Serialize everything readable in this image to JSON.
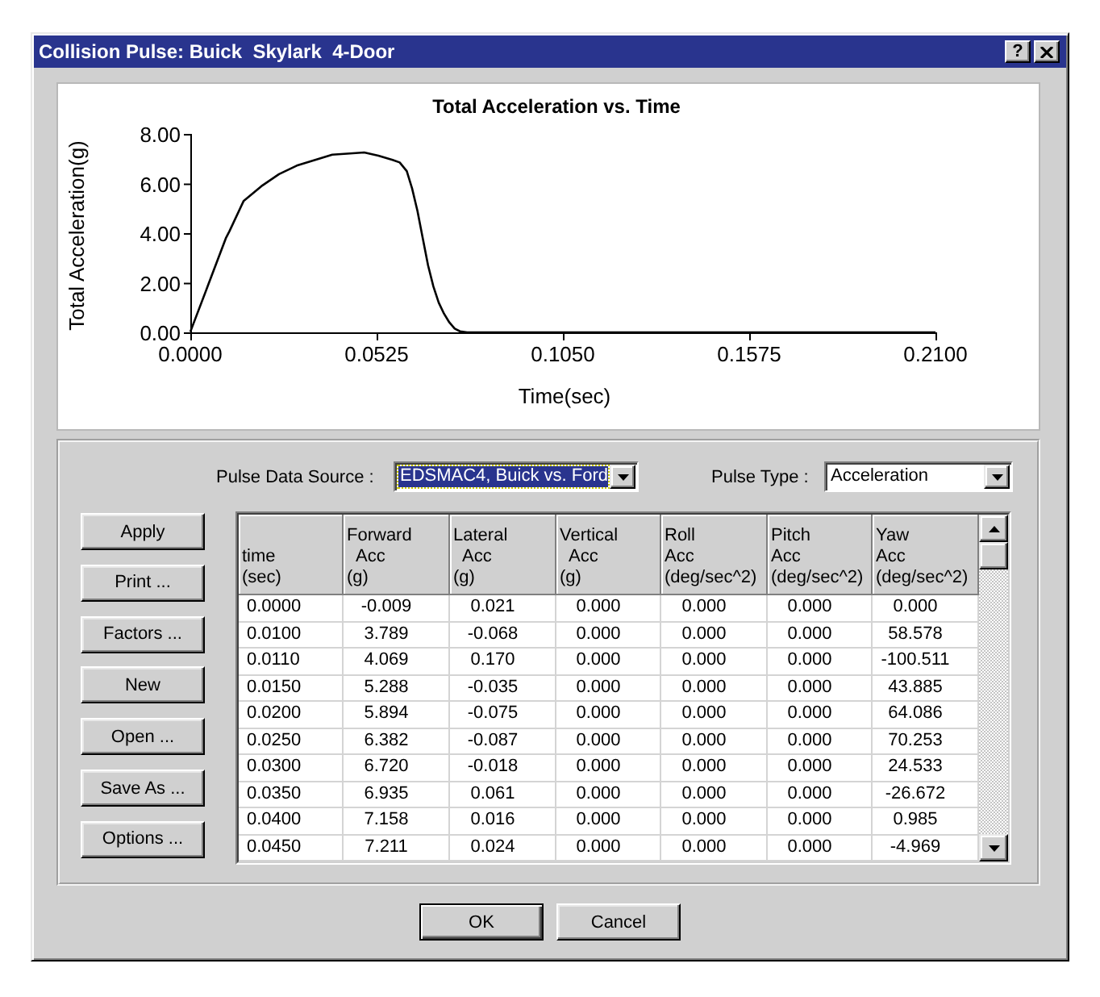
{
  "window": {
    "title": "Collision Pulse: Buick  Skylark  4-Door",
    "help_button": "?"
  },
  "chart": {
    "chart_data": {
      "type": "line",
      "title": "Total Acceleration vs. Time",
      "xlabel": "Time(sec)",
      "ylabel": "Total Acceleration(g)",
      "x": [
        0,
        0.005,
        0.01,
        0.011,
        0.015,
        0.02,
        0.025,
        0.03,
        0.035,
        0.04,
        0.045,
        0.049,
        0.053,
        0.057,
        0.059,
        0.061,
        0.0625,
        0.064,
        0.0655,
        0.067,
        0.0685,
        0.07,
        0.0715,
        0.073,
        0.0745,
        0.076,
        0.078,
        0.21
      ],
      "series": [
        {
          "color": "#000000",
          "values": [
            0.02,
            1.9,
            3.79,
            4.07,
            5.29,
            5.89,
            6.38,
            6.72,
            6.94,
            7.16,
            7.21,
            7.25,
            7.12,
            6.95,
            6.85,
            6.5,
            5.8,
            4.9,
            3.8,
            2.7,
            1.85,
            1.2,
            0.75,
            0.4,
            0.15,
            0.04,
            0,
            0
          ]
        }
      ],
      "xlim": [
        0,
        0.21
      ],
      "ylim": [
        0,
        8
      ],
      "xticks": [
        {
          "value": 0,
          "label": "0.0000"
        },
        {
          "value": 0.0525,
          "label": "0.0525"
        },
        {
          "value": 0.105,
          "label": "0.1050"
        },
        {
          "value": 0.1575,
          "label": "0.1575"
        },
        {
          "value": 0.21,
          "label": "0.2100"
        }
      ],
      "yticks": [
        {
          "value": 0,
          "label": "0.00"
        },
        {
          "value": 2,
          "label": "2.00"
        },
        {
          "value": 4,
          "label": "4.00"
        },
        {
          "value": 6,
          "label": "6.00"
        },
        {
          "value": 8,
          "label": "8.00"
        }
      ]
    }
  },
  "pulse_data_source": {
    "label": "Pulse Data Source :",
    "value": "EDSMAC4, Buick vs. Ford",
    "focused": true
  },
  "pulse_type": {
    "label": "Pulse Type :",
    "value": "Acceleration",
    "focused": false
  },
  "side_buttons": [
    "Apply",
    "Print ...",
    "Factors ...",
    "New",
    "Open ...",
    "Save As ...",
    "Options ..."
  ],
  "table": {
    "columns": [
      "time\n(sec)",
      "Forward\n  Acc\n(g)",
      "Lateral\n  Acc\n(g)",
      "Vertical\n  Acc\n(g)",
      "Roll\nAcc\n(deg/sec^2)",
      "Pitch\nAcc\n(deg/sec^2)",
      "Yaw\nAcc\n(deg/sec^2)"
    ],
    "rows": [
      [
        "0.0000",
        "-0.009",
        "0.021",
        "0.000",
        "0.000",
        "0.000",
        "0.000"
      ],
      [
        "0.0100",
        "3.789",
        "-0.068",
        "0.000",
        "0.000",
        "0.000",
        "58.578"
      ],
      [
        "0.0110",
        "4.069",
        "0.170",
        "0.000",
        "0.000",
        "0.000",
        "-100.511"
      ],
      [
        "0.0150",
        "5.288",
        "-0.035",
        "0.000",
        "0.000",
        "0.000",
        "43.885"
      ],
      [
        "0.0200",
        "5.894",
        "-0.075",
        "0.000",
        "0.000",
        "0.000",
        "64.086"
      ],
      [
        "0.0250",
        "6.382",
        "-0.087",
        "0.000",
        "0.000",
        "0.000",
        "70.253"
      ],
      [
        "0.0300",
        "6.720",
        "-0.018",
        "0.000",
        "0.000",
        "0.000",
        "24.533"
      ],
      [
        "0.0350",
        "6.935",
        "0.061",
        "0.000",
        "0.000",
        "0.000",
        "-26.672"
      ],
      [
        "0.0400",
        "7.158",
        "0.016",
        "0.000",
        "0.000",
        "0.000",
        "0.985"
      ],
      [
        "0.0450",
        "7.211",
        "0.024",
        "0.000",
        "0.000",
        "0.000",
        "-4.969"
      ]
    ]
  },
  "buttons": [
    {
      "label": "OK",
      "default": true
    },
    {
      "label": "Cancel",
      "default": false
    }
  ]
}
